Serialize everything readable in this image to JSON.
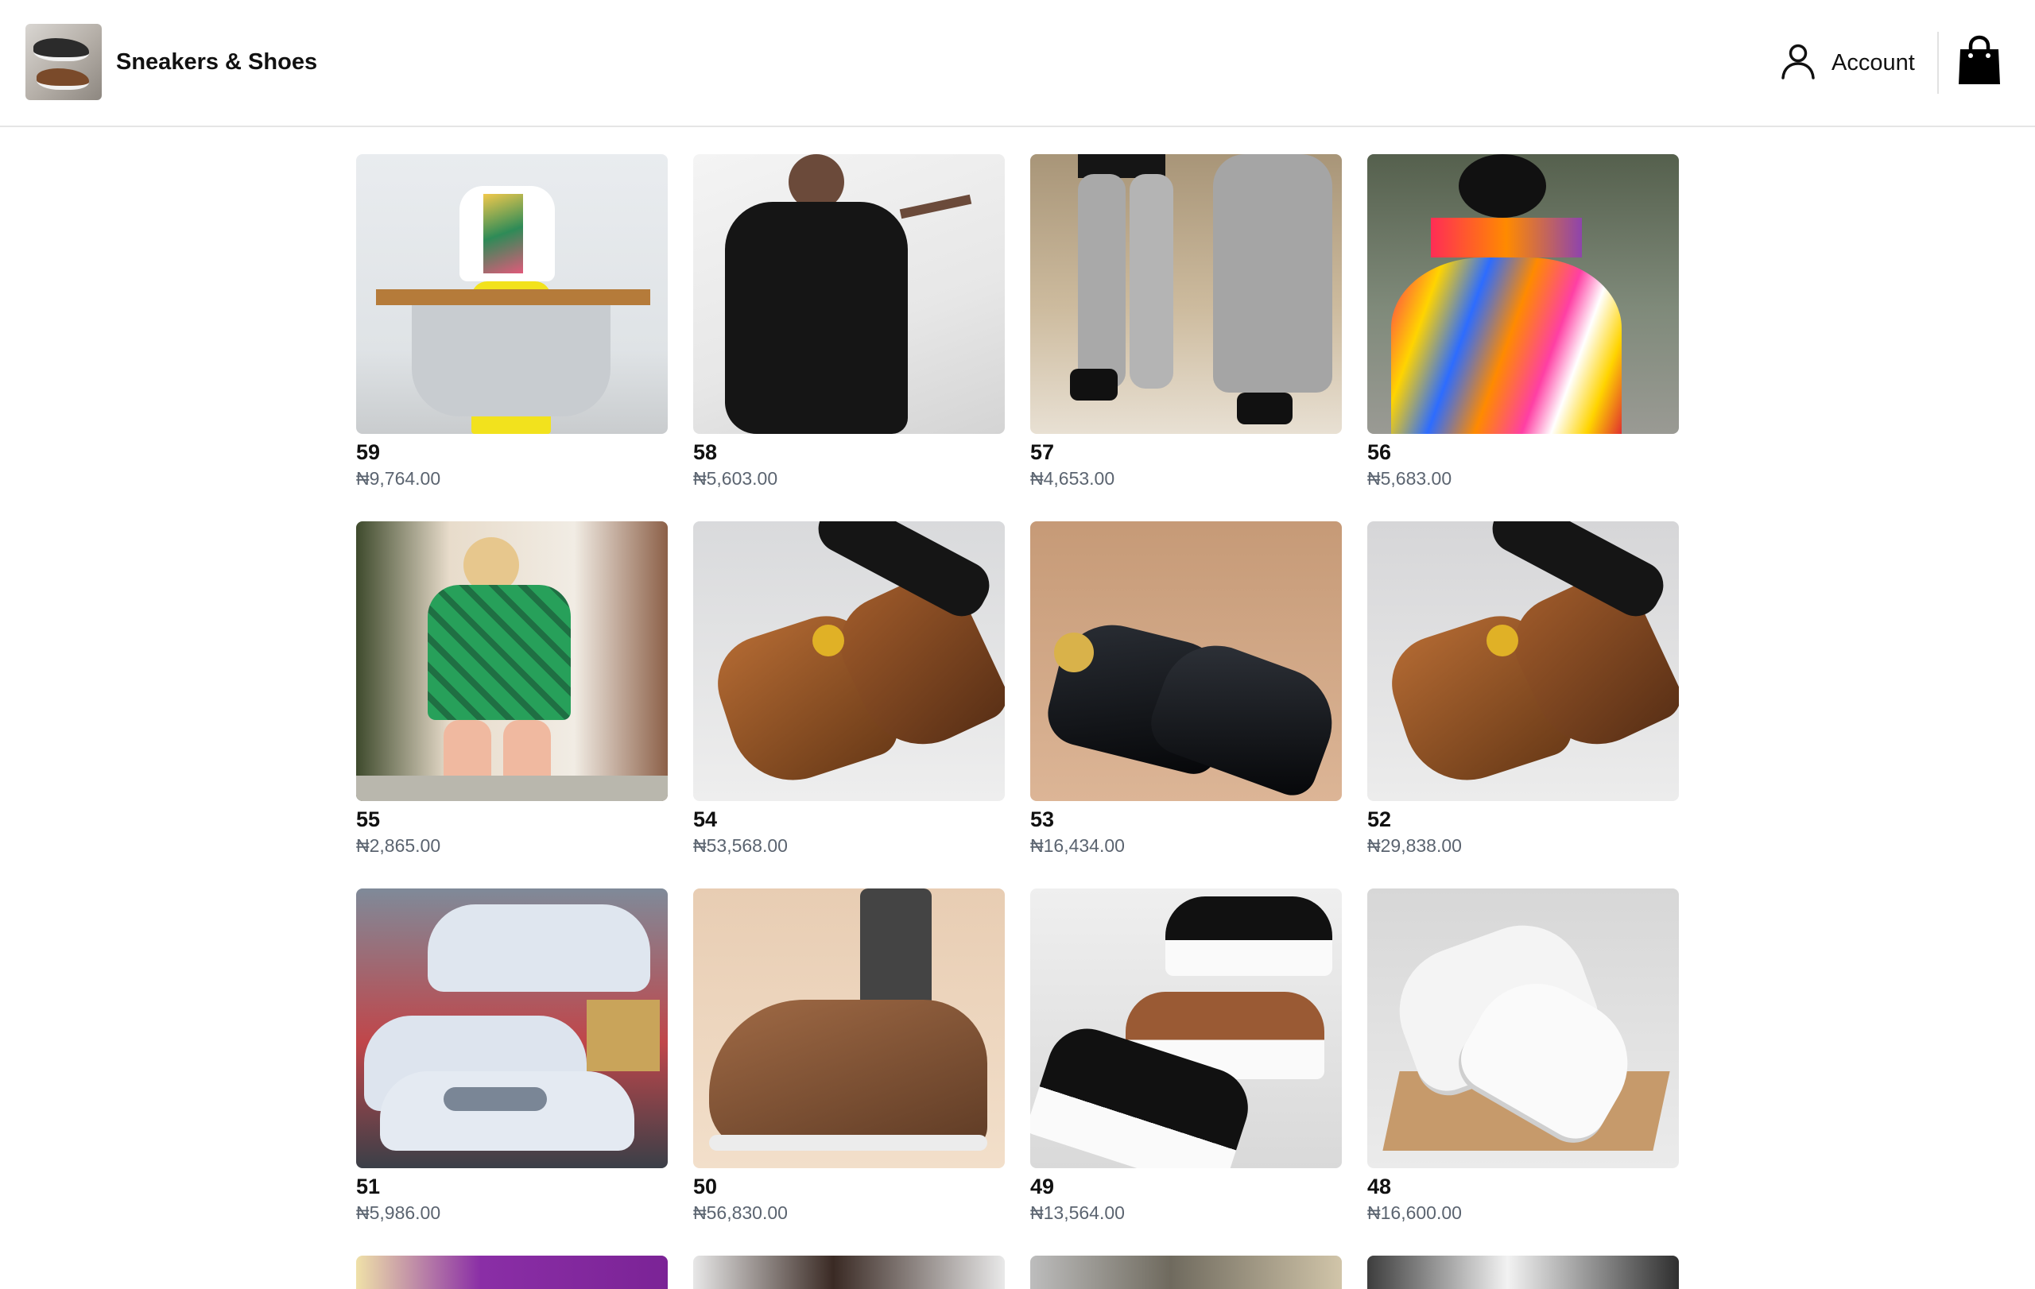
{
  "header": {
    "store_name": "Sneakers & Shoes",
    "account_label": "Account"
  },
  "icons": {
    "account": "user-icon",
    "cart": "shopping-bag-icon"
  },
  "colors": {
    "price_text": "#5b6470",
    "title_text": "#111111",
    "header_border": "#e5e5e5"
  },
  "products": [
    {
      "title": "59",
      "price": "₦9,764.00"
    },
    {
      "title": "58",
      "price": "₦5,603.00"
    },
    {
      "title": "57",
      "price": "₦4,653.00"
    },
    {
      "title": "56",
      "price": "₦5,683.00"
    },
    {
      "title": "55",
      "price": "₦2,865.00"
    },
    {
      "title": "54",
      "price": "₦53,568.00"
    },
    {
      "title": "53",
      "price": "₦16,434.00"
    },
    {
      "title": "52",
      "price": "₦29,838.00"
    },
    {
      "title": "51",
      "price": "₦5,986.00"
    },
    {
      "title": "50",
      "price": "₦56,830.00"
    },
    {
      "title": "49",
      "price": "₦13,564.00"
    },
    {
      "title": "48",
      "price": "₦16,600.00"
    }
  ]
}
